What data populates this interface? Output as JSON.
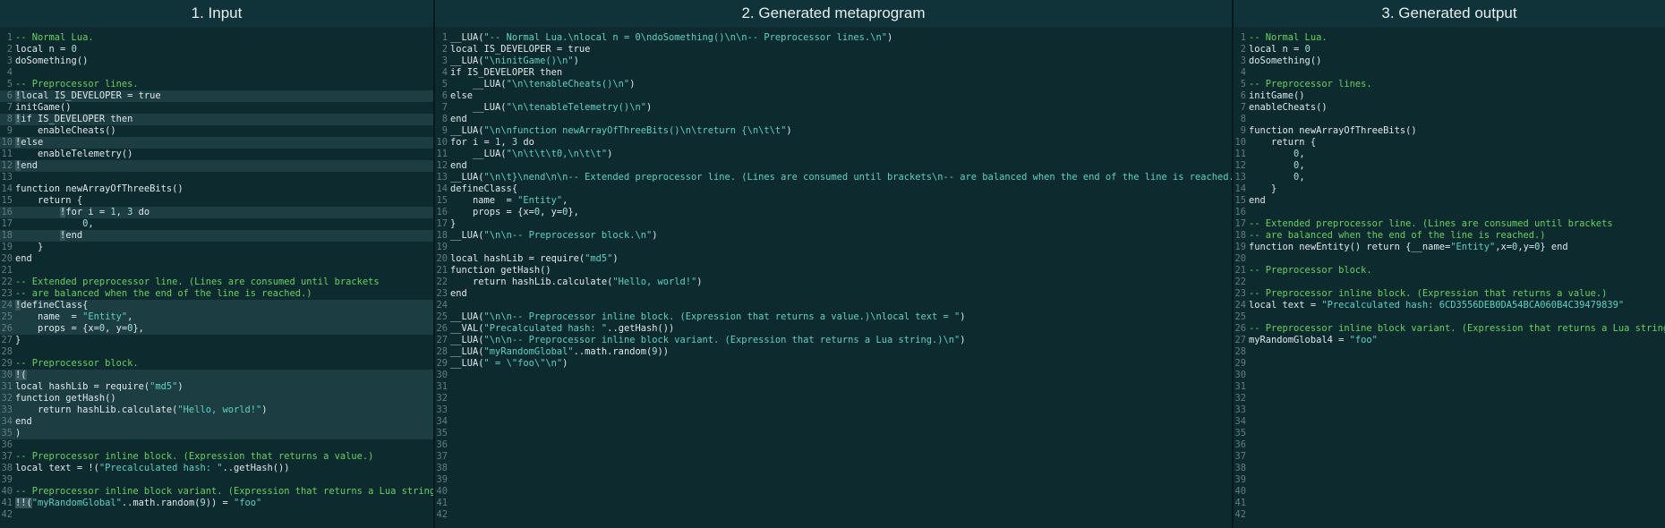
{
  "colors": {
    "background": "#0d2a2e",
    "header": "#0f3338",
    "comment": "#6bcf63",
    "string": "#5fd1c2",
    "code": "#dfe8ea",
    "preprocessor_highlight": "#36565b"
  },
  "panes": [
    {
      "title": "1. Input",
      "line_count": 42,
      "highlighted_rows": [
        6,
        8,
        10,
        12,
        16,
        18,
        24,
        25,
        26,
        30,
        31,
        32,
        33,
        34,
        35
      ],
      "lines": [
        {
          "n": 1,
          "t": "-- Normal Lua.",
          "k": "comment"
        },
        {
          "n": 2,
          "t": "local n = 0"
        },
        {
          "n": 3,
          "t": "doSomething()"
        },
        {
          "n": 5,
          "t": "-- Preprocessor lines.",
          "k": "comment"
        },
        {
          "n": 6,
          "t": "!local IS_DEVELOPER = true",
          "k": "pre"
        },
        {
          "n": 7,
          "t": "initGame()"
        },
        {
          "n": 8,
          "t": "!if IS_DEVELOPER then",
          "k": "pre"
        },
        {
          "n": 9,
          "t": "    enableCheats()"
        },
        {
          "n": 10,
          "t": "!else",
          "k": "pre"
        },
        {
          "n": 11,
          "t": "    enableTelemetry()"
        },
        {
          "n": 12,
          "t": "!end",
          "k": "pre"
        },
        {
          "n": 14,
          "t": "function newArrayOfThreeBits()"
        },
        {
          "n": 15,
          "t": "    return {"
        },
        {
          "n": 16,
          "t": "        !for i = 1, 3 do",
          "k": "pre"
        },
        {
          "n": 17,
          "t": "            0,"
        },
        {
          "n": 18,
          "t": "        !end",
          "k": "pre"
        },
        {
          "n": 19,
          "t": "    }"
        },
        {
          "n": 20,
          "t": "end"
        },
        {
          "n": 22,
          "t": "-- Extended preprocessor line. (Lines are consumed until brackets",
          "k": "comment"
        },
        {
          "n": 23,
          "t": "-- are balanced when the end of the line is reached.)",
          "k": "comment"
        },
        {
          "n": 24,
          "t": "!defineClass{",
          "k": "pre"
        },
        {
          "n": 25,
          "t": "    name  = \"Entity\","
        },
        {
          "n": 26,
          "t": "    props = {x=0, y=0},"
        },
        {
          "n": 27,
          "t": "}"
        },
        {
          "n": 29,
          "t": "-- Preprocessor block.",
          "k": "comment"
        },
        {
          "n": 30,
          "t": "!(",
          "k": "pre"
        },
        {
          "n": 31,
          "t": "local hashLib = require(\"md5\")"
        },
        {
          "n": 32,
          "t": "function getHash()"
        },
        {
          "n": 33,
          "t": "    return hashLib.calculate(\"Hello, world!\")"
        },
        {
          "n": 34,
          "t": "end"
        },
        {
          "n": 35,
          "t": ")"
        },
        {
          "n": 37,
          "t": "-- Preprocessor inline block. (Expression that returns a value.)",
          "k": "comment"
        },
        {
          "n": 38,
          "t": "local text = !(\"Precalculated hash: \"..getHash())"
        },
        {
          "n": 40,
          "t": "-- Preprocessor inline block variant. (Expression that returns a Lua string.)",
          "k": "comment"
        },
        {
          "n": 41,
          "t": "!!(\"myRandomGlobal\"..math.random(9)) = \"foo\"",
          "k": "pre"
        }
      ]
    },
    {
      "title": "2. Generated metaprogram",
      "line_count": 42,
      "highlighted_rows": [],
      "lines": [
        {
          "n": 1,
          "t": "__LUA(\"-- Normal Lua.\\nlocal n = 0\\ndoSomething()\\n\\n-- Preprocessor lines.\\n\")"
        },
        {
          "n": 2,
          "t": "local IS_DEVELOPER = true"
        },
        {
          "n": 3,
          "t": "__LUA(\"\\ninitGame()\\n\")"
        },
        {
          "n": 4,
          "t": "if IS_DEVELOPER then"
        },
        {
          "n": 5,
          "t": "    __LUA(\"\\n\\tenableCheats()\\n\")"
        },
        {
          "n": 6,
          "t": "else"
        },
        {
          "n": 7,
          "t": "    __LUA(\"\\n\\tenableTelemetry()\\n\")"
        },
        {
          "n": 8,
          "t": "end"
        },
        {
          "n": 9,
          "t": "__LUA(\"\\n\\nfunction newArrayOfThreeBits()\\n\\treturn {\\n\\t\\t\")"
        },
        {
          "n": 10,
          "t": "for i = 1, 3 do"
        },
        {
          "n": 11,
          "t": "    __LUA(\"\\n\\t\\t\\t0,\\n\\t\\t\")"
        },
        {
          "n": 12,
          "t": "end"
        },
        {
          "n": 13,
          "t": "__LUA(\"\\n\\t}\\nend\\n\\n-- Extended preprocessor line. (Lines are consumed until brackets\\n-- are balanced when the end of the line is reached.)\\n\")"
        },
        {
          "n": 14,
          "t": "defineClass{"
        },
        {
          "n": 15,
          "t": "    name  = \"Entity\","
        },
        {
          "n": 16,
          "t": "    props = {x=0, y=0},"
        },
        {
          "n": 17,
          "t": "}"
        },
        {
          "n": 18,
          "t": "__LUA(\"\\n\\n-- Preprocessor block.\\n\")"
        },
        {
          "n": 20,
          "t": "local hashLib = require(\"md5\")"
        },
        {
          "n": 21,
          "t": "function getHash()"
        },
        {
          "n": 22,
          "t": "    return hashLib.calculate(\"Hello, world!\")"
        },
        {
          "n": 23,
          "t": "end"
        },
        {
          "n": 25,
          "t": "__LUA(\"\\n\\n-- Preprocessor inline block. (Expression that returns a value.)\\nlocal text = \")"
        },
        {
          "n": 26,
          "t": "__VAL(\"Precalculated hash: \"..getHash())"
        },
        {
          "n": 27,
          "t": "__LUA(\"\\n\\n-- Preprocessor inline block variant. (Expression that returns a Lua string.)\\n\")"
        },
        {
          "n": 28,
          "t": "__LUA(\"myRandomGlobal\"..math.random(9))"
        },
        {
          "n": 29,
          "t": "__LUA(\" = \\\"foo\\\"\\n\")"
        }
      ]
    },
    {
      "title": "3. Generated output",
      "line_count": 42,
      "highlighted_rows": [],
      "lines": [
        {
          "n": 1,
          "t": "-- Normal Lua.",
          "k": "comment"
        },
        {
          "n": 2,
          "t": "local n = 0"
        },
        {
          "n": 3,
          "t": "doSomething()"
        },
        {
          "n": 5,
          "t": "-- Preprocessor lines.",
          "k": "comment"
        },
        {
          "n": 6,
          "t": "initGame()"
        },
        {
          "n": 7,
          "t": "enableCheats()"
        },
        {
          "n": 9,
          "t": "function newArrayOfThreeBits()"
        },
        {
          "n": 10,
          "t": "    return {"
        },
        {
          "n": 11,
          "t": "        0,"
        },
        {
          "n": 12,
          "t": "        0,"
        },
        {
          "n": 13,
          "t": "        0,"
        },
        {
          "n": 14,
          "t": "    }"
        },
        {
          "n": 15,
          "t": "end"
        },
        {
          "n": 17,
          "t": "-- Extended preprocessor line. (Lines are consumed until brackets",
          "k": "comment"
        },
        {
          "n": 18,
          "t": "-- are balanced when the end of the line is reached.)",
          "k": "comment"
        },
        {
          "n": 19,
          "t": "function newEntity() return {__name=\"Entity\",x=0,y=0} end"
        },
        {
          "n": 21,
          "t": "-- Preprocessor block.",
          "k": "comment"
        },
        {
          "n": 23,
          "t": "-- Preprocessor inline block. (Expression that returns a value.)",
          "k": "comment"
        },
        {
          "n": 24,
          "t": "local text = \"Precalculated hash: 6CD3556DEB0DA54BCA060B4C39479839\""
        },
        {
          "n": 26,
          "t": "-- Preprocessor inline block variant. (Expression that returns a Lua string.)",
          "k": "comment"
        },
        {
          "n": 27,
          "t": "myRandomGlobal4 = \"foo\""
        }
      ]
    }
  ]
}
